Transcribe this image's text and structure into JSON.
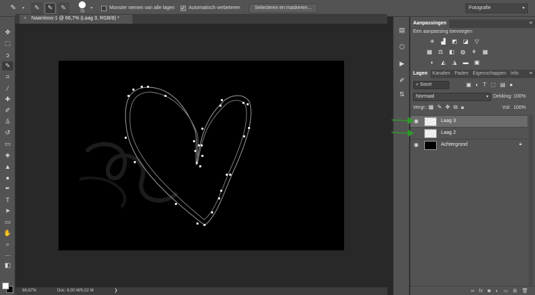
{
  "options_bar": {
    "tool_icon": "brush-icon",
    "brush_size": "70",
    "sample_all_layers": "Monster nemen van alle lagen",
    "auto_enhance": "Automatisch verbeteren",
    "auto_enhance_checked": true,
    "select_mask_button": "Selecteren en maskeren...",
    "workspace": "Fotografie"
  },
  "document": {
    "tab_title": "Naamloos-1 @ 66,7% (Laag 3, RGB/8) *"
  },
  "status": {
    "zoom": "66,67%",
    "doc_size": "Doc: 8,00 M/5,02 M"
  },
  "adjustments": {
    "title": "Aanpassingen",
    "subtitle": "Een aanpassing toevoegen"
  },
  "layers_panel": {
    "tabs": [
      "Lagen",
      "Kanalen",
      "Paden",
      "Eigenschappen",
      "Info"
    ],
    "filter_kind": "Soort",
    "blend_mode": "Normaal",
    "opacity_label": "Dekking:",
    "opacity_value": "100%",
    "lock_label": "Vergr.:",
    "fill_label": "Vul:",
    "fill_value": "100%",
    "layers": [
      {
        "name": "Laag 3",
        "selected": true,
        "visible": true,
        "thumb": "transparent"
      },
      {
        "name": "Laag 2",
        "selected": false,
        "visible": false,
        "thumb": "transparent"
      },
      {
        "name": "Achtergrond",
        "selected": false,
        "visible": true,
        "thumb": "black",
        "locked": true
      }
    ]
  },
  "colors": {
    "annotation_arrow": "#2f9a2a",
    "panel_bg": "#535353",
    "canvas_bg": "#000000"
  }
}
